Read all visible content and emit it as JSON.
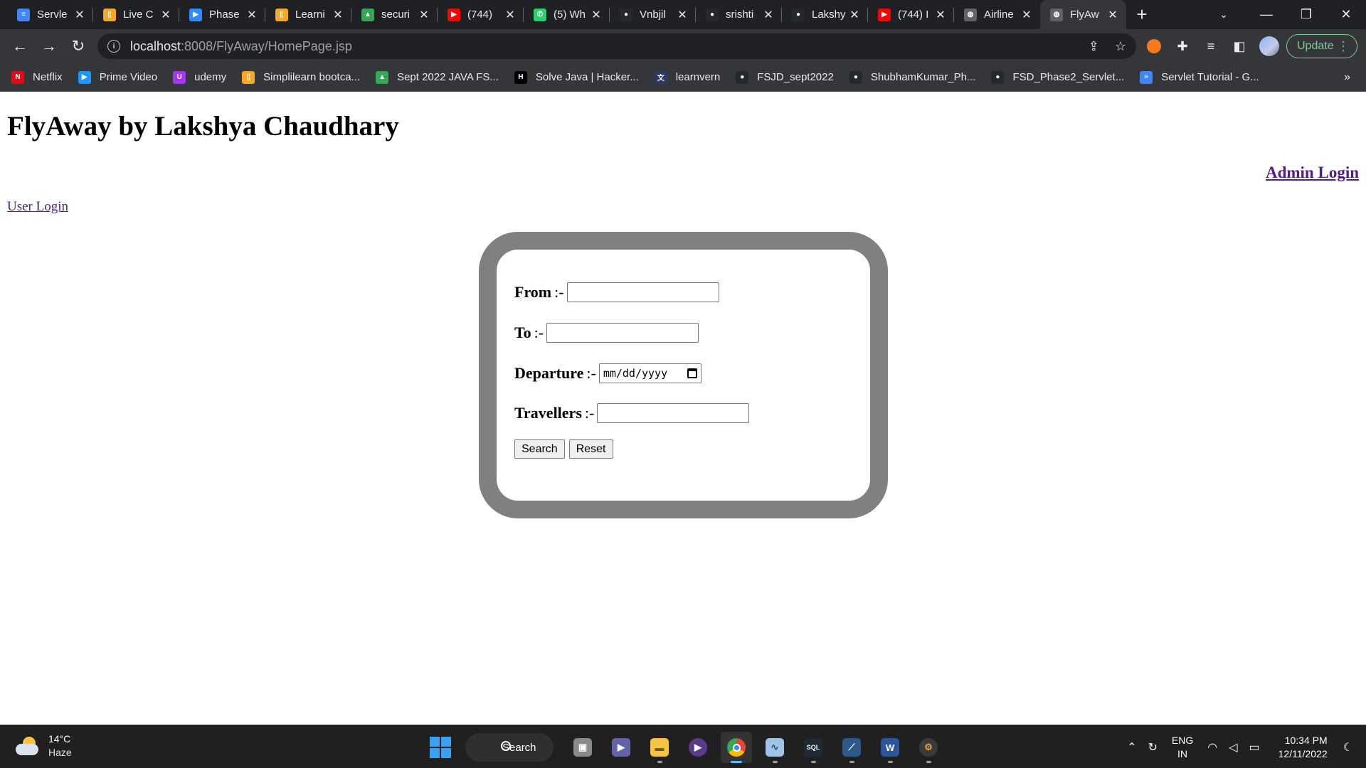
{
  "browser": {
    "tabs": [
      {
        "title": "Servle",
        "icon": "docs-icon",
        "color": "#4285f4",
        "glyph": "≡"
      },
      {
        "title": "Live C",
        "icon": "simplilearn-icon",
        "color": "#f9a825",
        "glyph": "|¦"
      },
      {
        "title": "Phase",
        "icon": "zoom-icon",
        "color": "#2d8cff",
        "glyph": "▶"
      },
      {
        "title": "Learni",
        "icon": "simplilearn-icon",
        "color": "#f9a825",
        "glyph": "|¦"
      },
      {
        "title": "securi",
        "icon": "drive-icon",
        "color": "#34a853",
        "glyph": "▲"
      },
      {
        "title": "(744)",
        "icon": "youtube-icon",
        "color": "#ff0000",
        "glyph": "▶"
      },
      {
        "title": "(5) Wh",
        "icon": "whatsapp-icon",
        "color": "#25d366",
        "glyph": "✆"
      },
      {
        "title": "Vnbjil",
        "icon": "github-icon",
        "color": "#24292e",
        "glyph": "●"
      },
      {
        "title": "srishti",
        "icon": "github-icon",
        "color": "#24292e",
        "glyph": "●"
      },
      {
        "title": "Lakshy",
        "icon": "github-icon",
        "color": "#24292e",
        "glyph": "●"
      },
      {
        "title": "(744) I",
        "icon": "youtube-icon",
        "color": "#ff0000",
        "glyph": "▶"
      },
      {
        "title": "Airline",
        "icon": "globe-icon",
        "color": "#5f6368",
        "glyph": "◍"
      },
      {
        "title": "FlyAw",
        "icon": "globe-icon",
        "color": "#5f6368",
        "glyph": "◍",
        "active": true
      }
    ],
    "url_host": "localhost",
    "url_path": ":8008/FlyAway/HomePage.jsp",
    "update_label": "Update",
    "bookmarks": [
      {
        "label": "Netflix",
        "color": "#e50914",
        "glyph": "N"
      },
      {
        "label": "Prime Video",
        "color": "#1a98ff",
        "glyph": "▶"
      },
      {
        "label": "udemy",
        "color": "#a435f0",
        "glyph": "U"
      },
      {
        "label": "Simplilearn bootca...",
        "color": "#f9a825",
        "glyph": "|¦"
      },
      {
        "label": "Sept 2022 JAVA FS...",
        "color": "#34a853",
        "glyph": "▲"
      },
      {
        "label": "Solve Java | Hacker...",
        "color": "#000000",
        "glyph": "H"
      },
      {
        "label": "learnvern",
        "color": "#2b3a67",
        "glyph": "文"
      },
      {
        "label": "FSJD_sept2022",
        "color": "#24292e",
        "glyph": "●"
      },
      {
        "label": "ShubhamKumar_Ph...",
        "color": "#24292e",
        "glyph": "●"
      },
      {
        "label": "FSD_Phase2_Servlet...",
        "color": "#24292e",
        "glyph": "●"
      },
      {
        "label": "Servlet Tutorial - G...",
        "color": "#4285f4",
        "glyph": "≡"
      }
    ]
  },
  "page": {
    "title": "FlyAway by Lakshya Chaudhary",
    "admin_link": "Admin Login",
    "user_link": "User Login",
    "form": {
      "from_label": "From",
      "to_label": "To",
      "departure_label": "Departure",
      "travellers_label": "Travellers",
      "separator": ":-",
      "date_placeholder": "mm/dd/yyyy",
      "search_button": "Search",
      "reset_button": "Reset"
    }
  },
  "taskbar": {
    "weather_temp": "14°C",
    "weather_desc": "Haze",
    "search_label": "Search",
    "lang_top": "ENG",
    "lang_bottom": "IN",
    "time": "10:34 PM",
    "date": "12/11/2022"
  }
}
